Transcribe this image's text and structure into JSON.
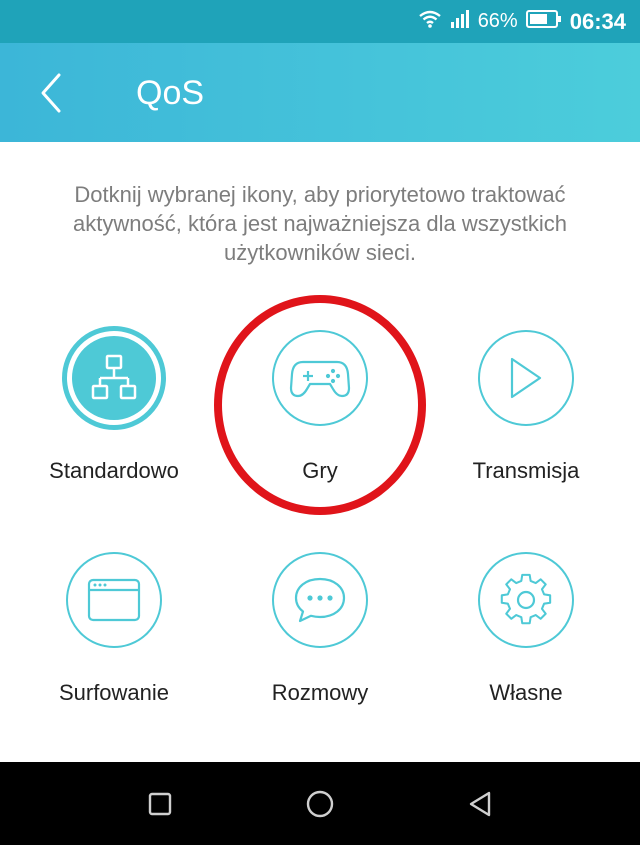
{
  "status_bar": {
    "battery": "66%",
    "time": "06:34"
  },
  "header": {
    "title": "QoS"
  },
  "intro_text": "Dotknij wybranej ikony, aby priorytetowo traktować aktywność, która jest najważniejsza dla wszystkich użytkowników sieci.",
  "tiles": [
    {
      "label": "Standardowo",
      "icon": "network-icon",
      "active": true
    },
    {
      "label": "Gry",
      "icon": "gamepad-icon",
      "active": false,
      "highlighted": true
    },
    {
      "label": "Transmisja",
      "icon": "play-icon",
      "active": false
    },
    {
      "label": "Surfowanie",
      "icon": "browser-window-icon",
      "active": false
    },
    {
      "label": "Rozmowy",
      "icon": "chat-bubble-icon",
      "active": false
    },
    {
      "label": "Własne",
      "icon": "gear-icon",
      "active": false
    }
  ],
  "colors": {
    "status_bar": "#1fa3b9",
    "header_start": "#3cb6d8",
    "header_end": "#4ccddb",
    "accent": "#4ec9d6",
    "highlight": "#e0141a"
  }
}
